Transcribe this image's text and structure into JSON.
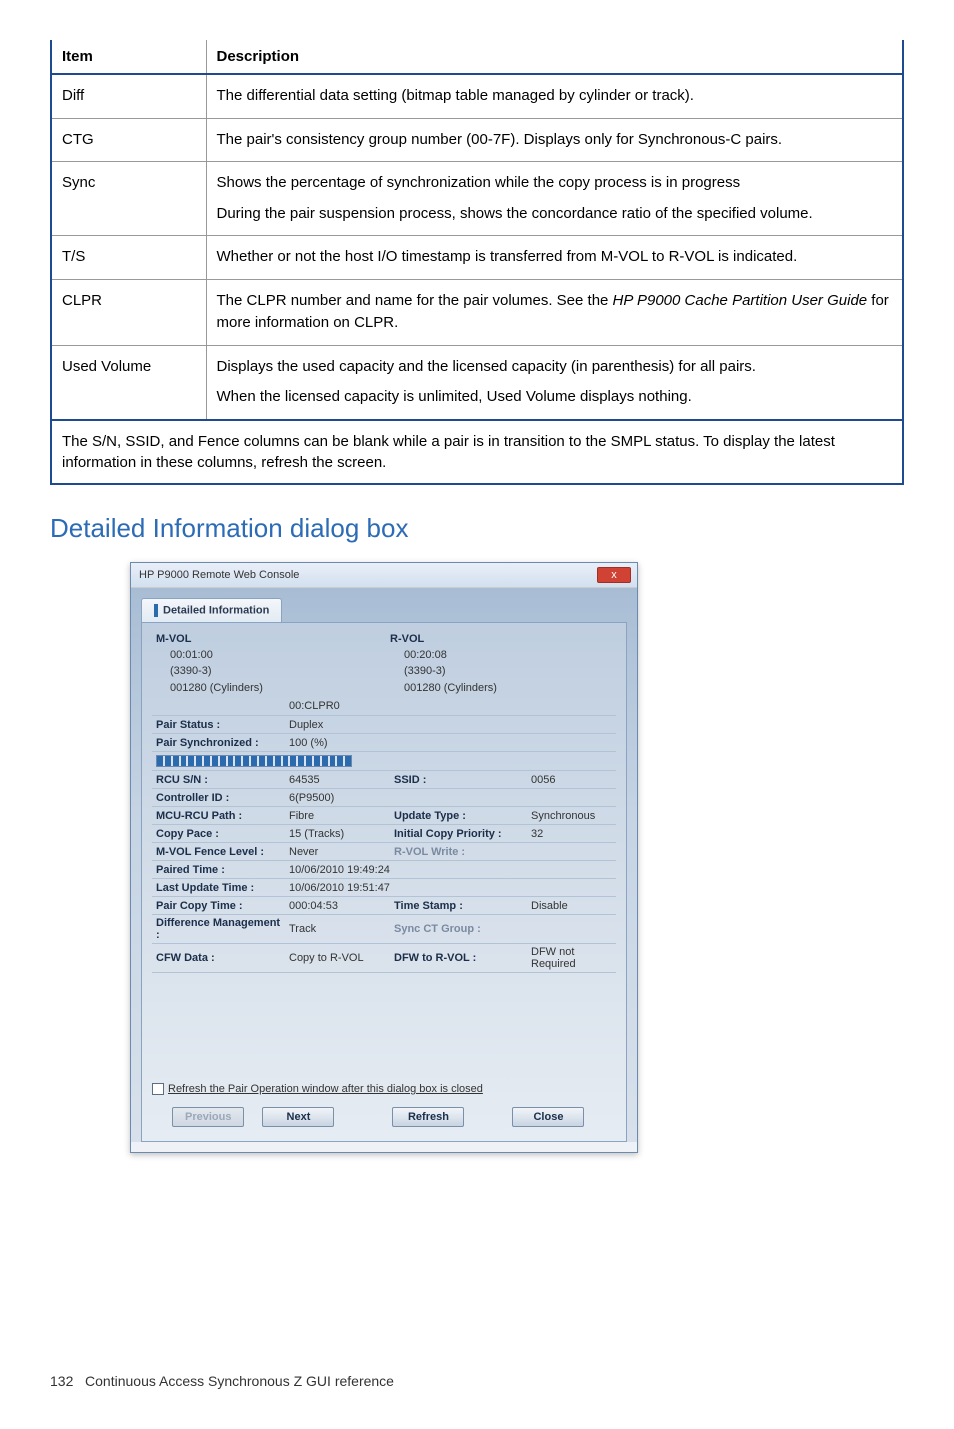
{
  "table": {
    "headers": [
      "Item",
      "Description"
    ],
    "rows": [
      {
        "item": "Diff",
        "desc": "The differential data setting (bitmap table managed by cylinder or track)."
      },
      {
        "item": "CTG",
        "desc": "The pair's consistency group number (00-7F). Displays only for Synchronous-C pairs."
      },
      {
        "item": "Sync",
        "desc": "Shows the percentage of synchronization while the copy process is in progress",
        "desc2": "During the pair suspension process, shows the concordance ratio of the specified volume."
      },
      {
        "item": "T/S",
        "desc": "Whether or not the host I/O timestamp is transferred from M-VOL to R-VOL is indicated."
      },
      {
        "item": "CLPR",
        "desc_pre": "The CLPR number and name for the pair volumes. See the ",
        "desc_em": "HP P9000 Cache Partition User Guide",
        "desc_post": " for more information on CLPR."
      },
      {
        "item": "Used Volume",
        "desc": "Displays the used capacity and the licensed capacity (in parenthesis) for all pairs.",
        "desc2": "When the licensed capacity is unlimited, Used Volume displays nothing."
      }
    ],
    "footnote": "The S/N, SSID, and Fence columns can be blank while a pair is in transition to the SMPL status. To display the latest information in these columns, refresh the screen."
  },
  "heading": "Detailed Information dialog box",
  "dialog": {
    "window_title": "HP P9000 Remote Web Console",
    "tab_label": "Detailed Information",
    "mvol": {
      "label": "M-VOL",
      "line1": "00:01:00",
      "line2": "(3390-3)",
      "line3": "001280 (Cylinders)"
    },
    "rvol": {
      "label": "R-VOL",
      "line1": "00:20:08",
      "line2": "(3390-3)",
      "line3": "001280 (Cylinders)"
    },
    "clpr": "00:CLPR0",
    "rows": {
      "pair_status": {
        "label": "Pair Status :",
        "val": "Duplex"
      },
      "pair_sync": {
        "label": "Pair Synchronized :",
        "val": "100 (%)"
      },
      "rcu_sn": {
        "label": "RCU S/N :",
        "val": "64535",
        "label2": "SSID :",
        "val2": "0056"
      },
      "controller_id": {
        "label": "Controller ID :",
        "val": "6(P9500)"
      },
      "mcu_rcu_path": {
        "label": "MCU-RCU Path :",
        "val": "Fibre",
        "label2": "Update Type :",
        "val2": "Synchronous"
      },
      "copy_pace": {
        "label": "Copy Pace :",
        "val": "15 (Tracks)",
        "label2": "Initial Copy Priority :",
        "val2": "32"
      },
      "mvol_fence": {
        "label": "M-VOL Fence Level :",
        "val": "Never",
        "label2": "R-VOL Write :",
        "val2": ""
      },
      "paired_time": {
        "label": "Paired Time :",
        "val": "10/06/2010 19:49:24"
      },
      "last_update": {
        "label": "Last Update Time :",
        "val": "10/06/2010 19:51:47"
      },
      "pair_copy_time": {
        "label": "Pair Copy Time :",
        "val": "000:04:53",
        "label2": "Time Stamp :",
        "val2": "Disable"
      },
      "diff_mgmt": {
        "label": "Difference Management :",
        "val": "Track",
        "label2": "Sync CT Group :",
        "val2": ""
      },
      "cfw_data": {
        "label": "CFW Data :",
        "val": "Copy to R-VOL",
        "label2": "DFW to R-VOL :",
        "val2": "DFW not Required"
      }
    },
    "refresh_checkbox": "Refresh the Pair Operation window after this dialog box is closed",
    "buttons": {
      "previous": "Previous",
      "next": "Next",
      "refresh": "Refresh",
      "close": "Close"
    }
  },
  "footer": {
    "page": "132",
    "text": "Continuous Access Synchronous Z GUI reference"
  }
}
